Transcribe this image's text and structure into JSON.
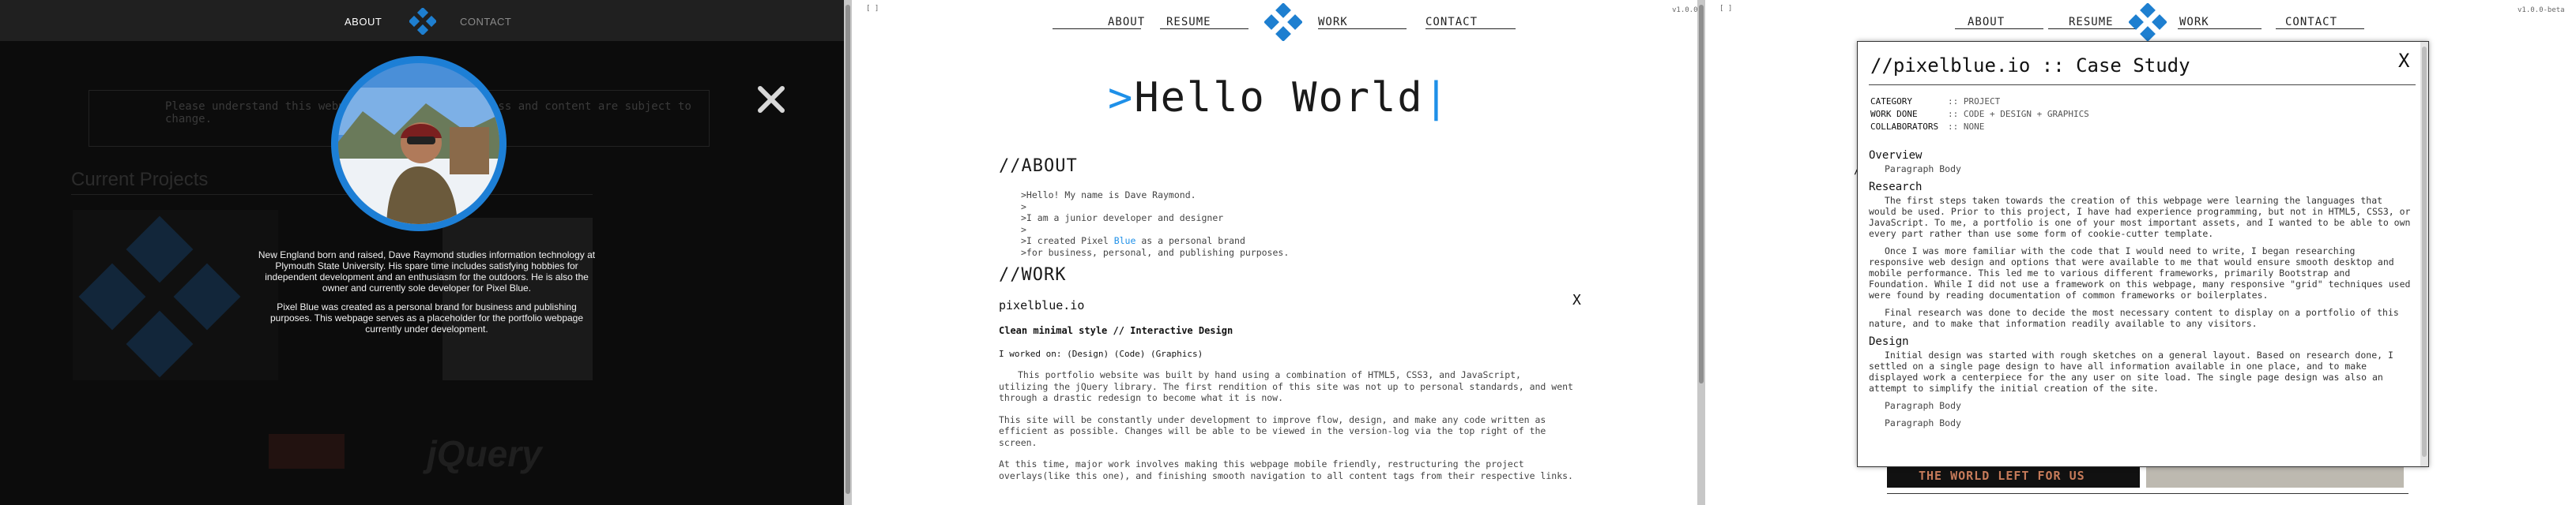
{
  "panel_about": {
    "nav": {
      "about": "ABOUT",
      "contact": "CONTACT"
    },
    "bg_notice": "Please understand this webpage is a work in progress and content are subject to change.",
    "bg_current_projects": "Current Projects",
    "bg_jquery": "jQuery",
    "bio": {
      "p1": "New England born and raised, Dave Raymond studies information technology at Plymouth State University. His spare time includes satisfying hobbies for independent development and an enthusiasm for the outdoors. He is also the owner and currently sole developer for Pixel Blue.",
      "p2": "Pixel Blue was created as a personal brand for business and publishing purposes. This webpage serves as a placeholder for the portfolio webpage currently under development."
    },
    "close_label": "close"
  },
  "panel_home": {
    "corner_left": "[ ]",
    "version": "v1.0.0",
    "nav": {
      "about": "ABOUT",
      "resume": "RESUME",
      "work": "WORK",
      "contact": "CONTACT"
    },
    "hero": {
      "prompt": ">",
      "text": "Hello World",
      "cursor": "|"
    },
    "about_heading": "//ABOUT",
    "about_lines": {
      "l1": ">Hello! My name is Dave Raymond.",
      "l2": ">",
      "l3": ">I am a junior developer and designer",
      "l4": ">",
      "l5a": ">I created Pixel ",
      "l5b": "Blue",
      "l5c": " as a personal brand",
      "l6": ">for business, personal, and publishing purposes."
    },
    "work_heading": "//WORK",
    "work": {
      "title": "pixelblue.io",
      "close": "X",
      "subtitle": "Clean minimal style // Interactive Design",
      "worked_on": "I worked on: (Design) (Code) (Graphics)",
      "p1": "This portfolio website was built by hand using a combination of HTML5, CSS3, and JavaScript, utilizing the jQuery library. The first rendition of this site was not up to personal standards, and went through a drastic redesign to become what it is now.",
      "p2": "This site will be constantly under development to improve flow, design, and make any code written as efficient as possible. Changes will be able to be viewed in the version-log via the top right of the screen.",
      "p3": "At this time, major work involves making this webpage mobile friendly, restructuring the project overlays(like this one), and finishing smooth navigation to all content tags from their respective links."
    }
  },
  "panel_case": {
    "corner_left": "[ ]",
    "version": "v1.0.0-beta",
    "nav": {
      "about": "ABOUT",
      "resume": "RESUME",
      "work": "WORK",
      "contact": "CONTACT"
    },
    "modal": {
      "title": "//pixelblue.io :: Case Study",
      "close": "X",
      "meta": {
        "category_k": "CATEGORY",
        "category_v": ":: PROJECT",
        "workdone_k": "WORK DONE",
        "workdone_v": ":: CODE + DESIGN + GRAPHICS",
        "collab_k": "COLLABORATORS",
        "collab_v": ":: NONE"
      },
      "overview_h": "Overview",
      "overview_p": "Paragraph Body",
      "research_h": "Research",
      "research_p1": "The first steps taken towards the creation of this webpage were learning the languages that would be used. Prior to this project, I have had experience programming, but not in HTML5, CSS3, or JavaScript. To me, a portfolio is one of your most important assets, and I wanted to be able to own every part rather than use some form of cookie-cutter template.",
      "research_p2": "Once I was more familiar with the code that I would need to write, I began researching responsive web design and options that were available to me that would ensure smooth desktop and mobile performance. This led me to various different frameworks, primarily Bootstrap and Foundation. While I did not use a framework on this webpage, many responsive \"grid\" techniques used were found by reading documentation of common frameworks or boilerplates.",
      "research_p3": "Final research was done to decide the most necessary content to display on a portfolio of this nature, and to make that information readily available to any visitors.",
      "design_h": "Design",
      "design_p1": "Initial design was started with rough sketches on a general layout. Based on research done, I settled on a single page design to have all information available in one place, and to make displayed work a centerpiece for the any user on site load. The single page design was also an attempt to simplify the initial creation of the site.",
      "design_pb1": "Paragraph Body",
      "design_pb2": "Paragraph Body"
    },
    "bg_slash": "/",
    "banner": "THE WORLD LEFT FOR US"
  }
}
